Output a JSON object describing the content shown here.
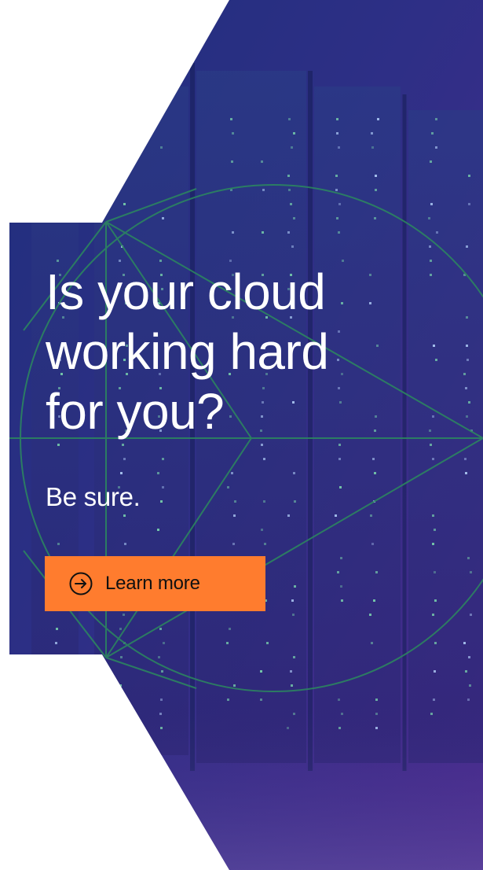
{
  "ad": {
    "headline_lines": [
      "Is your cloud",
      "working hard",
      "for you?"
    ],
    "subline": "Be sure.",
    "cta": {
      "label": "Learn more",
      "icon": "arrow-right-circle-icon"
    }
  },
  "colors": {
    "background_deep_blue": "#2a2a80",
    "background_violet": "#4a2a8c",
    "cta_orange": "#ff7c2e",
    "line_art_green": "#2c8a5e",
    "text_white": "#ffffff",
    "cta_text": "#111111"
  }
}
